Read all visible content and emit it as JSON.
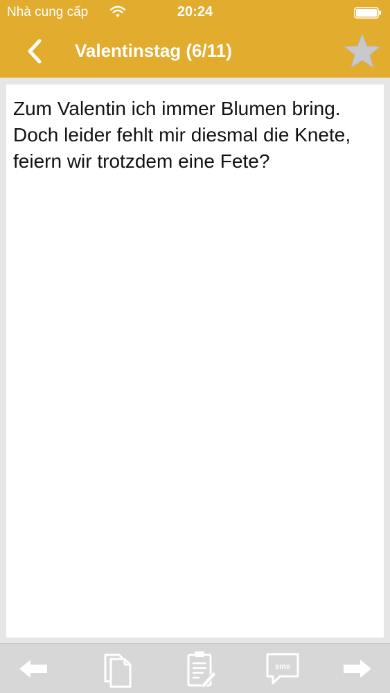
{
  "status_bar": {
    "carrier": "Nhà cung cấp",
    "time": "20:24"
  },
  "nav": {
    "title": "Valentinstag (6/11)"
  },
  "content": {
    "message": "Zum Valentin ich immer Blumen bring. Doch leider fehlt mir diesmal die Knete, feiern wir trotzdem eine Fete?"
  },
  "toolbar": {
    "sms_label": "sms"
  },
  "colors": {
    "accent": "#e2ac2e",
    "icon_gray": "#ffffff",
    "star": "#c9c9c9",
    "toolbar_bg": "#d7d7d7",
    "page_bg": "#e6e6e6"
  },
  "icons": {
    "back": "chevron-left-icon",
    "favorite": "star-icon",
    "previous": "arrow-left-icon",
    "copy": "copy-icon",
    "edit": "clipboard-edit-icon",
    "sms": "sms-icon",
    "next": "arrow-right-icon"
  }
}
